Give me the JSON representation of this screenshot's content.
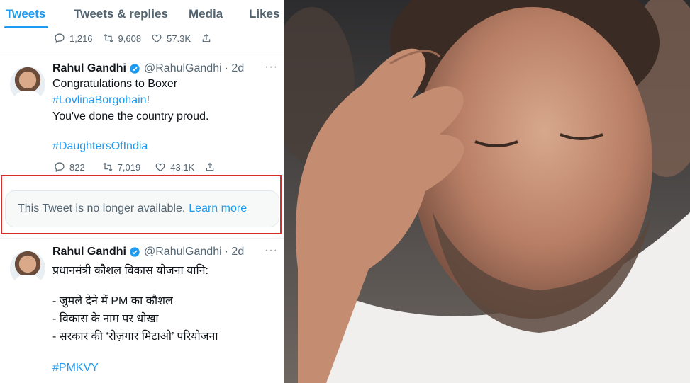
{
  "tabs": [
    "Tweets",
    "Tweets & replies",
    "Media",
    "Likes"
  ],
  "top_stats": {
    "replies": "1,216",
    "retweets": "9,608",
    "likes": "57.3K"
  },
  "tweet1": {
    "name": "Rahul Gandhi",
    "handle": "@RahulGandhi",
    "time": "· 2d",
    "more": "···",
    "line1": "Congratulations to Boxer",
    "line2_tag": "#LovlinaBorgohain",
    "line2_rest": "!",
    "line3": "You've done the country proud.",
    "line4_tag": "#DaughtersOfIndia",
    "stats": {
      "replies": "822",
      "retweets": "7,019",
      "likes": "43.1K"
    }
  },
  "unavailable": {
    "message": "This Tweet is no longer available.",
    "link": "Learn more"
  },
  "tweet2": {
    "name": "Rahul Gandhi",
    "handle": "@RahulGandhi",
    "time": "· 2d",
    "more": "···",
    "line1": "प्रधानमंत्री कौशल विकास योजना यानि:",
    "line2": "- जुमले देने में PM का कौशल",
    "line3": "- विकास के नाम पर धोखा",
    "line4": "- सरकार की ‘रोज़गार मिटाओ’ परियोजना",
    "line5_tag": "#PMKVY"
  },
  "colors": {
    "accent": "#1d9bf0",
    "highlight_border": "#d92d2a",
    "muted": "#536471"
  }
}
